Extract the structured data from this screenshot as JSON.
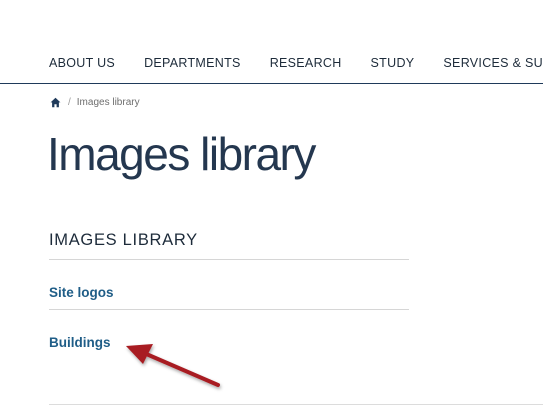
{
  "nav": {
    "items": [
      {
        "label": "ABOUT US"
      },
      {
        "label": "DEPARTMENTS"
      },
      {
        "label": "RESEARCH"
      },
      {
        "label": "STUDY"
      },
      {
        "label": "SERVICES & SUPPORT"
      }
    ]
  },
  "breadcrumb": {
    "home_icon": "home-icon",
    "separator": "/",
    "current": "Images library"
  },
  "page": {
    "title": "Images library"
  },
  "section": {
    "heading": "IMAGES LIBRARY",
    "links": [
      {
        "label": "Site logos"
      },
      {
        "label": "Buildings"
      }
    ]
  },
  "annotation": {
    "arrow_color": "#a81c22",
    "arrow_icon": "pointer-arrow-icon"
  },
  "colors": {
    "nav_text": "#1d2b3a",
    "title": "#24374f",
    "link": "#1f5d87",
    "nav_rule": "#1f3a5a"
  }
}
